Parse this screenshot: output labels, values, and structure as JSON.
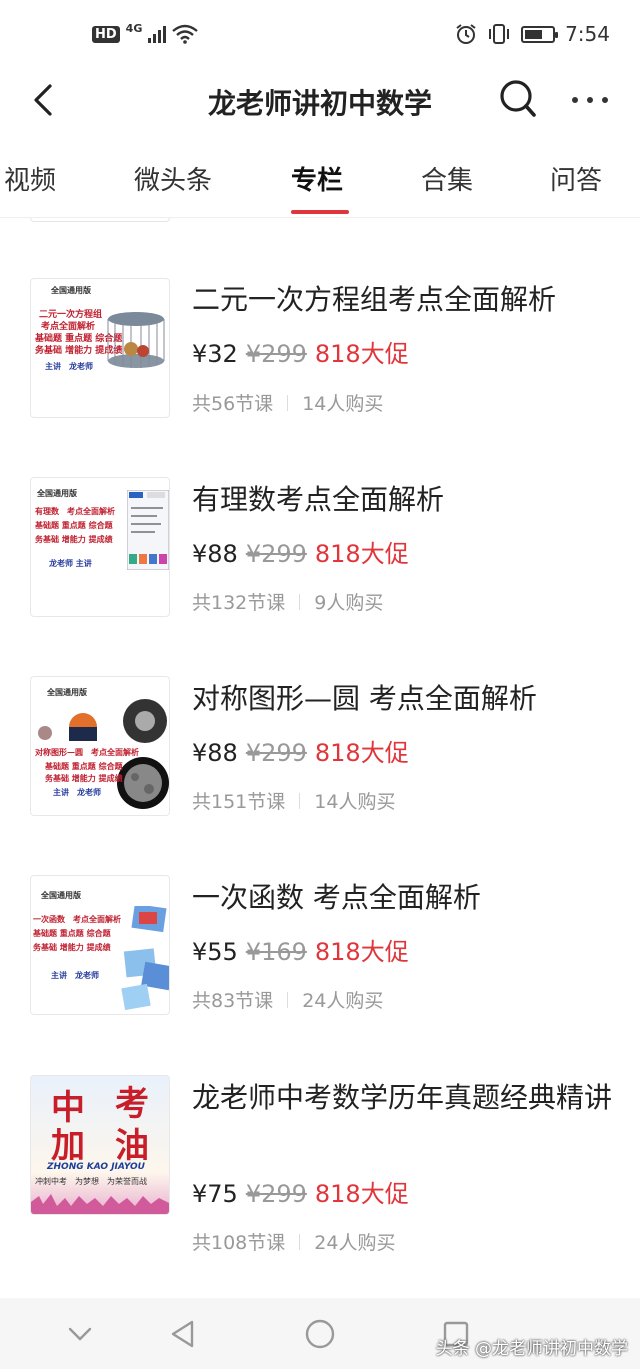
{
  "status_bar": {
    "hd": "HD",
    "network": "4G",
    "time": "7:54"
  },
  "header": {
    "title": "龙老师讲初中数学",
    "back_icon": "chevron-left-icon",
    "search_icon": "search-icon",
    "more_icon": "more-dots-icon"
  },
  "tabs": [
    {
      "label": "视频",
      "active": false
    },
    {
      "label": "微头条",
      "active": false
    },
    {
      "label": "专栏",
      "active": true
    },
    {
      "label": "合集",
      "active": false
    },
    {
      "label": "问答",
      "active": false
    }
  ],
  "accent_color": "#e0353a",
  "courses": [
    {
      "title": "二元一次方程组考点全面解析",
      "price": "¥32",
      "original_price": "¥299",
      "promo": "818大促",
      "lessons": "共56节课",
      "buyers": "14人购买",
      "thumb": {
        "tag": "全国通用版",
        "lines": [
          "二元一次方程组",
          "考点全面解析",
          "基础题 重点题 综合题",
          "务基础 增能力 提成绩"
        ],
        "author": "主讲　龙老师"
      }
    },
    {
      "title": "有理数考点全面解析",
      "price": "¥88",
      "original_price": "¥299",
      "promo": "818大促",
      "lessons": "共132节课",
      "buyers": "9人购买",
      "thumb": {
        "tag": "全国通用版",
        "lines": [
          "有理数　考点全面解析",
          "基础题 重点题 综合题",
          "务基础 增能力 提成绩"
        ],
        "author": "龙老师 主讲"
      }
    },
    {
      "title": "对称图形—圆 考点全面解析",
      "price": "¥88",
      "original_price": "¥299",
      "promo": "818大促",
      "lessons": "共151节课",
      "buyers": "14人购买",
      "thumb": {
        "tag": "全国通用版",
        "lines": [
          "对称图形—圆　考点全面解析",
          "基础题 重点题 综合题",
          "务基础 增能力 提成绩"
        ],
        "author": "主讲　龙老师"
      }
    },
    {
      "title": "一次函数 考点全面解析",
      "price": "¥55",
      "original_price": "¥169",
      "promo": "818大促",
      "lessons": "共83节课",
      "buyers": "24人购买",
      "thumb": {
        "tag": "全国通用版",
        "lines": [
          "一次函数　考点全面解析",
          "基础题 重点题 综合题",
          "务基础 增能力 提成绩"
        ],
        "author": "主讲　龙老师"
      }
    },
    {
      "title": "龙老师中考数学历年真题经典精讲",
      "price": "¥75",
      "original_price": "¥299",
      "promo": "818大促",
      "lessons": "共108节课",
      "buyers": "24人购买",
      "thumb": {
        "big_chars": [
          "中",
          "考",
          "加",
          "油"
        ],
        "pinyin": "ZHONG KAO  JIAYOU",
        "slogan": "冲刺中考　为梦想　为荣誉而战"
      }
    }
  ],
  "bottom_nav": {
    "icons": [
      "chevron-down-icon",
      "back-triangle-icon",
      "home-circle-icon",
      "recents-square-icon"
    ],
    "watermark": "头条 @龙老师讲初中数学"
  }
}
